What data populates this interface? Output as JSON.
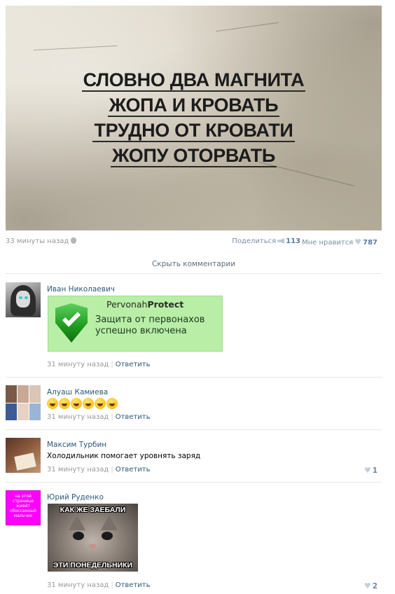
{
  "post": {
    "image_lines": [
      "СЛОВНО ДВА МАГНИТА",
      "ЖОПА И КРОВАТЬ",
      "ТРУДНО ОТ КРОВАТИ",
      "ЖОПУ ОТОРВАТЬ"
    ],
    "time": "33 минуты назад",
    "share_label": "Поделиться",
    "share_count": "113",
    "like_label": "Мне нравится",
    "like_count": "787"
  },
  "hide_comments_label": "Скрыть комментарии",
  "comments": [
    {
      "author": "Иван Николаевич",
      "banner": {
        "brand_regular": "Pervonah",
        "brand_bold": "Protect",
        "message_line1": "Защита от первонахов",
        "message_line2": "успешно включена"
      },
      "time": "31 минуту назад",
      "reply": "Ответить"
    },
    {
      "author": "Алуаш Камиева",
      "emoji_icons": [
        "laugh-icon",
        "laugh-icon",
        "laugh-icon",
        "laugh-icon",
        "laugh-icon",
        "laugh-icon"
      ],
      "time": "31 минуту назад",
      "reply": "Ответить"
    },
    {
      "author": "Максим Турбин",
      "text": "Холодильник помогает уровнять заряд",
      "time": "31 минуту назад",
      "reply": "Ответить",
      "likes": "1"
    },
    {
      "author": "Юрий Руденко",
      "avatar_text": "на этой странице живёт обоссанный мальчик",
      "meme_top": "КАК ЖЕ ЗАЕБАЛИ",
      "meme_bottom": "ЭТИ ПОНЕДЕЛЬНИКИ",
      "time": "31 минуту назад",
      "reply": "Ответить",
      "likes": "2"
    }
  ],
  "colors": {
    "link": "#2b587a",
    "muted": "#999999",
    "banner_bg": "#b8eea6",
    "avatar_magenta": "#ff00ff"
  }
}
